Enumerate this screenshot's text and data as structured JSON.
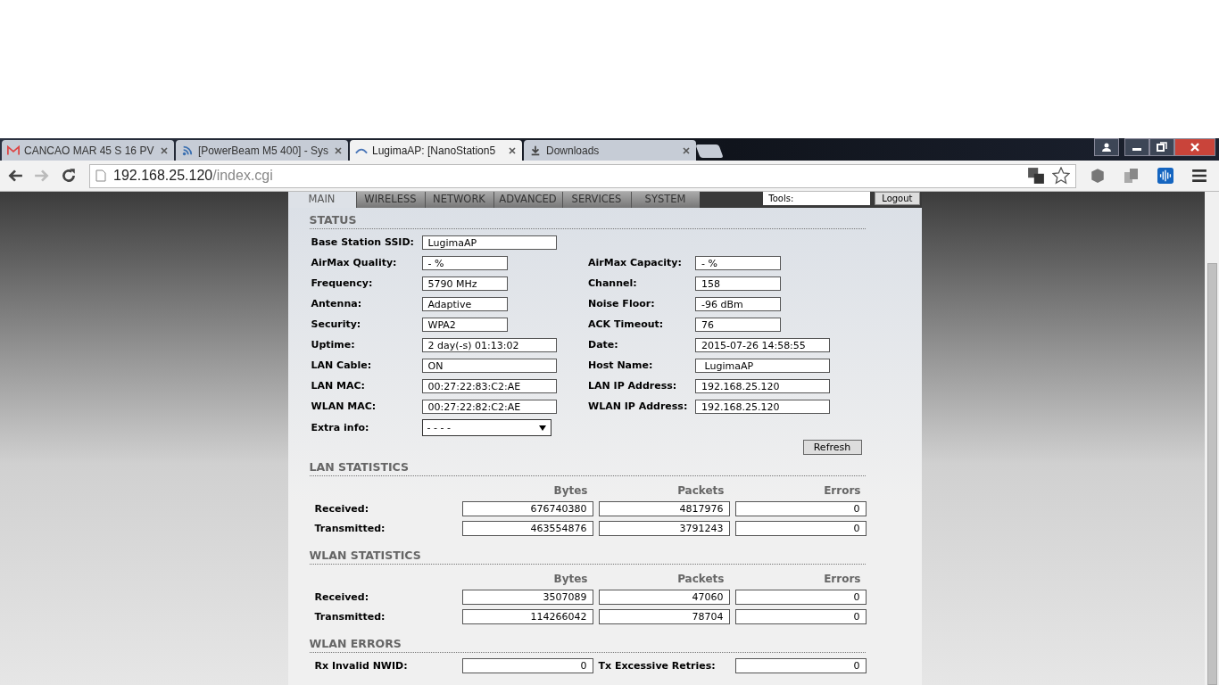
{
  "browser": {
    "tabs": [
      {
        "title": "CANCAO MAR 45 S 16 PV",
        "selected": false
      },
      {
        "title": "[PowerBeam M5 400] - Sys",
        "selected": false
      },
      {
        "title": "LugimaAP: [NanoStation5",
        "selected": true
      },
      {
        "title": "Downloads",
        "selected": false
      }
    ],
    "address": {
      "host": "192.168.25.120",
      "path": "/index.cgi"
    }
  },
  "nav_tabs": [
    {
      "label": "MAIN",
      "selected": true
    },
    {
      "label": "WIRELESS",
      "selected": false
    },
    {
      "label": "NETWORK",
      "selected": false
    },
    {
      "label": "ADVANCED",
      "selected": false
    },
    {
      "label": "SERVICES",
      "selected": false
    },
    {
      "label": "SYSTEM",
      "selected": false
    }
  ],
  "tools": {
    "value": "Tools:"
  },
  "logout": "Logout",
  "status": {
    "title": "STATUS",
    "ssid": {
      "label": "Base Station SSID:",
      "value": "LugimaAP"
    },
    "rows": [
      [
        {
          "label": "AirMax Quality:",
          "value": "- %",
          "kind": "short"
        },
        {
          "label": "AirMax Capacity:",
          "value": "- %",
          "kind": "short"
        }
      ],
      [
        {
          "label": "Frequency:",
          "value": "5790 MHz",
          "kind": "short"
        },
        {
          "label": "Channel:",
          "value": "158",
          "kind": "short"
        }
      ],
      [
        {
          "label": "Antenna:",
          "value": "Adaptive",
          "kind": "short"
        },
        {
          "label": "Noise Floor:",
          "value": "-96 dBm",
          "kind": "short"
        }
      ],
      [
        {
          "label": "Security:",
          "value": "WPA2",
          "kind": "short"
        },
        {
          "label": "ACK Timeout:",
          "value": "76",
          "kind": "short"
        }
      ],
      [
        {
          "label": "Uptime:",
          "value": "2 day(-s) 01:13:02",
          "kind": "long"
        },
        {
          "label": "Date:",
          "value": "2015-07-26 14:58:55",
          "kind": "long"
        }
      ],
      [
        {
          "label": "LAN Cable:",
          "value": "ON",
          "kind": "long"
        },
        {
          "label": "Host Name:",
          "value": " LugimaAP",
          "kind": "long"
        }
      ],
      [
        {
          "label": "LAN MAC:",
          "value": "00:27:22:83:C2:AE",
          "kind": "long"
        },
        {
          "label": "LAN IP Address:",
          "value": "192.168.25.120",
          "kind": "long"
        }
      ],
      [
        {
          "label": "WLAN MAC:",
          "value": "00:27:22:82:C2:AE",
          "kind": "long"
        },
        {
          "label": "WLAN IP Address:",
          "value": "192.168.25.120",
          "kind": "long"
        }
      ]
    ],
    "extra": {
      "label": "Extra info:",
      "value": "- - - -"
    },
    "refresh": "Refresh"
  },
  "stat_sections": [
    {
      "title": "LAN STATISTICS",
      "columns": [
        "Bytes",
        "Packets",
        "Errors"
      ],
      "rows": [
        {
          "label": "Received:",
          "values": [
            "676740380",
            "4817976",
            "0"
          ]
        },
        {
          "label": "Transmitted:",
          "values": [
            "463554876",
            "3791243",
            "0"
          ]
        }
      ]
    },
    {
      "title": "WLAN STATISTICS",
      "columns": [
        "Bytes",
        "Packets",
        "Errors"
      ],
      "rows": [
        {
          "label": "Received:",
          "values": [
            "3507089",
            "47060",
            "0"
          ]
        },
        {
          "label": "Transmitted:",
          "values": [
            "114266042",
            "78704",
            "0"
          ]
        }
      ]
    }
  ],
  "wlan_errors": {
    "title": "WLAN ERRORS",
    "items": [
      {
        "label": "Rx Invalid NWID:",
        "value": "0"
      },
      {
        "label": "Tx Excessive Retries:",
        "value": "0"
      }
    ]
  }
}
